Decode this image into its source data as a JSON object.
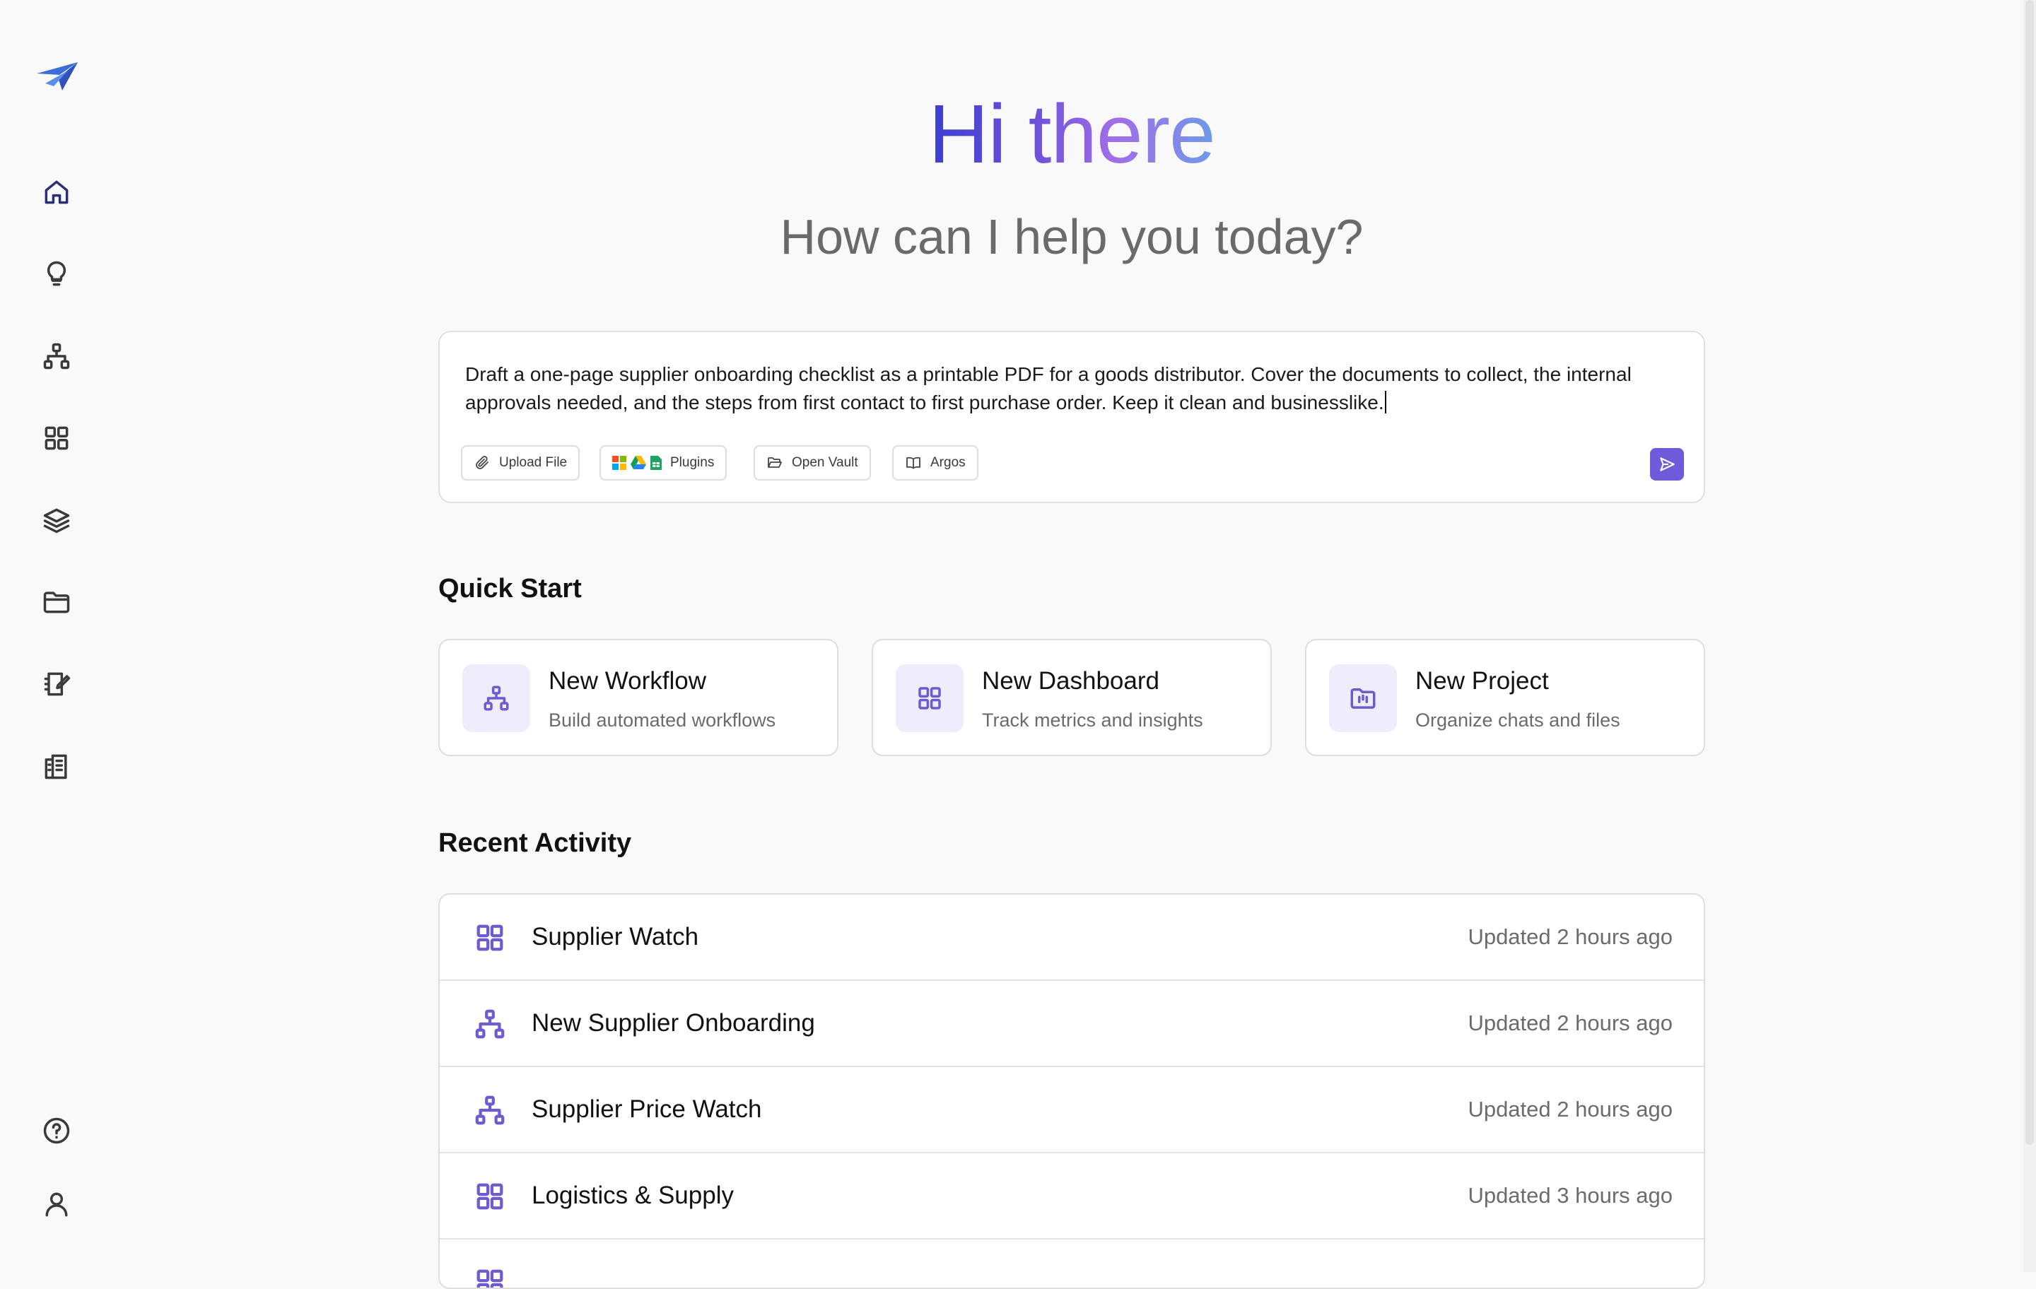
{
  "greeting": {
    "title": "Hi there",
    "subtitle": "How can I help you today?"
  },
  "prompt": {
    "text": "Draft a one-page supplier onboarding checklist as a printable PDF for a goods distributor. Cover the documents to collect, the internal approvals needed, and the steps from first contact to first purchase order. Keep it clean and businesslike.",
    "tools": [
      {
        "label": "Upload File",
        "icon": "paperclip-icon"
      },
      {
        "label": "Plugins",
        "icon": "plugins-icon"
      },
      {
        "label": "Open Vault",
        "icon": "folder-open-icon"
      },
      {
        "label": "Argos",
        "icon": "book-icon"
      }
    ],
    "send_icon": "send-icon"
  },
  "quick_start": {
    "title": "Quick Start",
    "cards": [
      {
        "title": "New Workflow",
        "subtitle": "Build automated workflows",
        "icon": "workflow-icon"
      },
      {
        "title": "New Dashboard",
        "subtitle": "Track metrics and insights",
        "icon": "dashboard-icon"
      },
      {
        "title": "New Project",
        "subtitle": "Organize chats and files",
        "icon": "project-folder-icon"
      }
    ]
  },
  "recent_activity": {
    "title": "Recent Activity",
    "items": [
      {
        "name": "Supplier Watch",
        "time": "Updated 2 hours ago",
        "icon": "dashboard-icon"
      },
      {
        "name": "New Supplier Onboarding",
        "time": "Updated 2 hours ago",
        "icon": "workflow-icon"
      },
      {
        "name": "Supplier Price Watch",
        "time": "Updated 2 hours ago",
        "icon": "workflow-icon"
      },
      {
        "name": "Logistics & Supply",
        "time": "Updated 3 hours ago",
        "icon": "dashboard-icon"
      },
      {
        "name": "",
        "time": "",
        "icon": "dashboard-icon"
      }
    ]
  },
  "sidebar": {
    "items": [
      "home-icon",
      "lightbulb-icon",
      "workflow-icon",
      "dashboard-icon",
      "layers-icon",
      "folder-icon",
      "notebook-icon",
      "building-icon"
    ],
    "bottom": [
      "help-icon",
      "user-icon"
    ]
  },
  "colors": {
    "accent": "#6f5bd9",
    "icon_purple": "#6d5bd0",
    "tile_bg": "#efedfb"
  }
}
